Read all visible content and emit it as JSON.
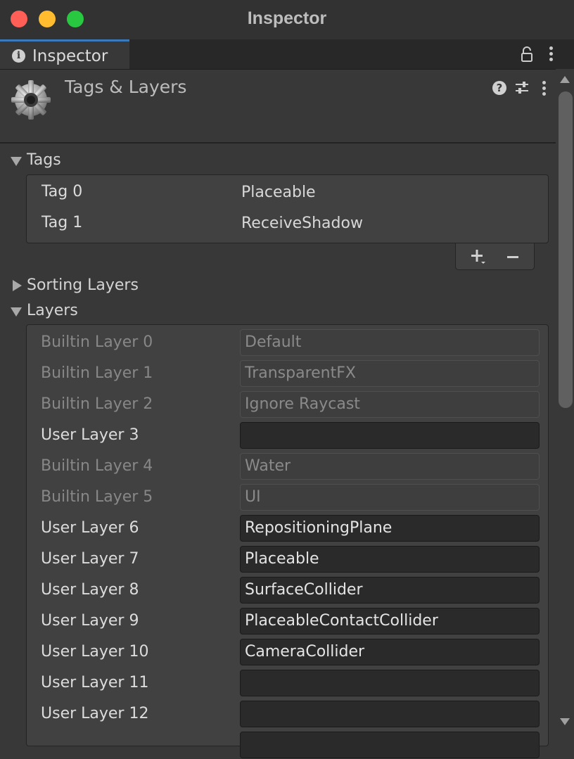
{
  "window": {
    "title": "Inspector"
  },
  "tab": {
    "label": "Inspector",
    "icon": "info-icon"
  },
  "header": {
    "title": "Tags & Layers",
    "icon": "gear-icon"
  },
  "tags": {
    "label": "Tags",
    "expanded": true,
    "items": [
      {
        "label": "Tag 0",
        "value": "Placeable"
      },
      {
        "label": "Tag 1",
        "value": "ReceiveShadow"
      }
    ]
  },
  "sorting_layers": {
    "label": "Sorting Layers",
    "expanded": false
  },
  "layers": {
    "label": "Layers",
    "expanded": true,
    "items": [
      {
        "label": "Builtin Layer 0",
        "value": "Default",
        "builtin": true
      },
      {
        "label": "Builtin Layer 1",
        "value": "TransparentFX",
        "builtin": true
      },
      {
        "label": "Builtin Layer 2",
        "value": "Ignore Raycast",
        "builtin": true
      },
      {
        "label": "User Layer 3",
        "value": "",
        "builtin": false
      },
      {
        "label": "Builtin Layer 4",
        "value": "Water",
        "builtin": true
      },
      {
        "label": "Builtin Layer 5",
        "value": "UI",
        "builtin": true
      },
      {
        "label": "User Layer 6",
        "value": "RepositioningPlane",
        "builtin": false
      },
      {
        "label": "User Layer 7",
        "value": "Placeable",
        "builtin": false
      },
      {
        "label": "User Layer 8",
        "value": "SurfaceCollider",
        "builtin": false
      },
      {
        "label": "User Layer 9",
        "value": "PlaceableContactCollider",
        "builtin": false
      },
      {
        "label": "User Layer 10",
        "value": "CameraCollider",
        "builtin": false
      },
      {
        "label": "User Layer 11",
        "value": "",
        "builtin": false
      },
      {
        "label": "User Layer 12",
        "value": "",
        "builtin": false
      }
    ]
  },
  "colors": {
    "accent": "#3a79bb",
    "background": "#383838",
    "field": "#2a2a2a"
  }
}
